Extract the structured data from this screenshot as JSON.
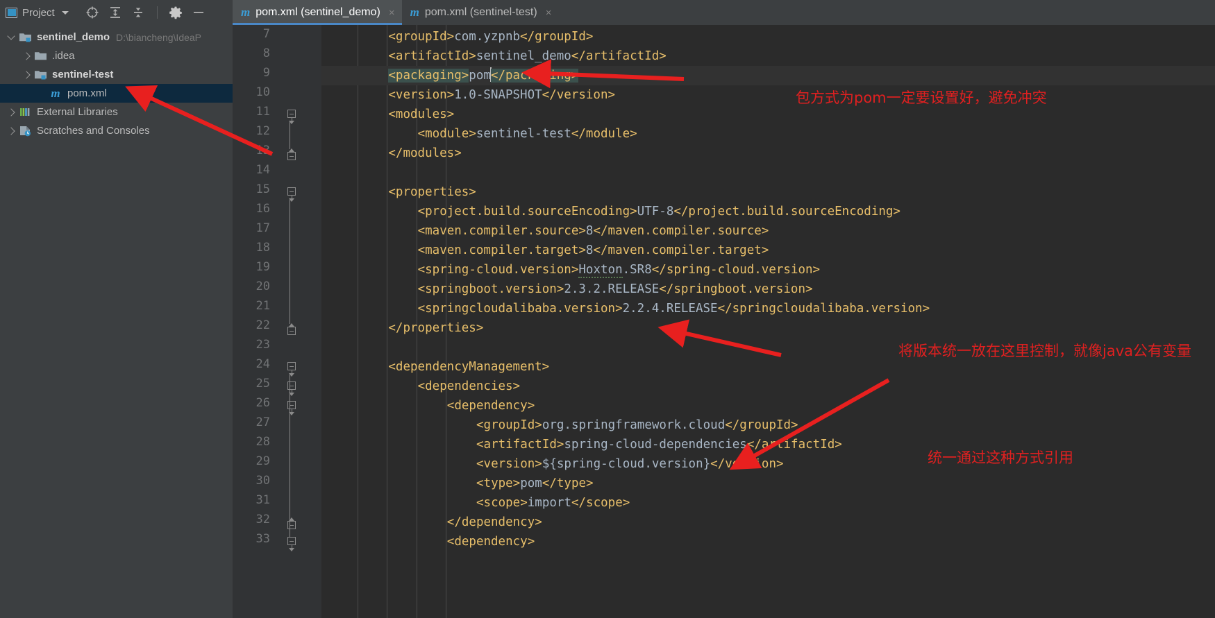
{
  "project_toolbar": {
    "label": "Project",
    "dropdown_caret": "chevron-down-icon",
    "icons": [
      "locate-icon",
      "expand-all-icon",
      "collapse-all-icon",
      "settings-gear-icon",
      "minimize-icon"
    ]
  },
  "tabs": [
    {
      "icon": "m",
      "label": "pom.xml (sentinel_demo)",
      "close": "×",
      "active": true
    },
    {
      "icon": "m",
      "label": "pom.xml (sentinel-test)",
      "close": "×",
      "active": false
    }
  ],
  "tree": [
    {
      "label": "sentinel_demo",
      "path": "D:\\biancheng\\IdeaP",
      "arrow": "open",
      "indent": 1,
      "icon": "module-folder-icon",
      "bold": true,
      "selected": false
    },
    {
      "label": ".idea",
      "path": "",
      "arrow": "closed",
      "indent": 2,
      "icon": "folder-icon",
      "bold": false,
      "selected": false
    },
    {
      "label": "sentinel-test",
      "path": "",
      "arrow": "closed",
      "indent": 2,
      "icon": "module-folder-icon",
      "bold": true,
      "selected": false
    },
    {
      "label": "pom.xml",
      "path": "",
      "arrow": "none",
      "indent": 3,
      "icon": "maven-m-icon",
      "bold": false,
      "selected": true
    },
    {
      "label": "External Libraries",
      "path": "",
      "arrow": "closed",
      "indent": 1,
      "icon": "libraries-icon",
      "bold": false,
      "selected": false
    },
    {
      "label": "Scratches and Consoles",
      "path": "",
      "arrow": "closed",
      "indent": 1,
      "icon": "scratches-icon",
      "bold": false,
      "selected": false
    }
  ],
  "editor": {
    "first_line_number": 7,
    "caret_line": 9,
    "lines": [
      {
        "n": 7,
        "indent": 2,
        "segs": [
          {
            "t": "<groupId>",
            "c": "tg"
          },
          {
            "t": "com.yzpnb",
            "c": "val"
          },
          {
            "t": "</groupId>",
            "c": "tg"
          }
        ]
      },
      {
        "n": 8,
        "indent": 2,
        "segs": [
          {
            "t": "<artifactId>",
            "c": "tg"
          },
          {
            "t": "sentinel_demo",
            "c": "val"
          },
          {
            "t": "</artifactId>",
            "c": "tg"
          }
        ]
      },
      {
        "n": 9,
        "indent": 2,
        "segs": [
          {
            "t": "<packaging>",
            "c": "tg hl"
          },
          {
            "t": "pom",
            "c": "val"
          },
          {
            "t": "CARET",
            "c": "caret"
          },
          {
            "t": "</packaging>",
            "c": "tg hl"
          }
        ]
      },
      {
        "n": 10,
        "indent": 2,
        "segs": [
          {
            "t": "<version>",
            "c": "tg"
          },
          {
            "t": "1.0-SNAPSHOT",
            "c": "val"
          },
          {
            "t": "</version>",
            "c": "tg"
          }
        ]
      },
      {
        "n": 11,
        "indent": 2,
        "segs": [
          {
            "t": "<modules>",
            "c": "tg"
          }
        ]
      },
      {
        "n": 12,
        "indent": 3,
        "segs": [
          {
            "t": "<module>",
            "c": "tg"
          },
          {
            "t": "sentinel-test",
            "c": "val"
          },
          {
            "t": "</module>",
            "c": "tg"
          }
        ]
      },
      {
        "n": 13,
        "indent": 2,
        "segs": [
          {
            "t": "</modules>",
            "c": "tg"
          }
        ]
      },
      {
        "n": 14,
        "indent": 0,
        "segs": []
      },
      {
        "n": 15,
        "indent": 2,
        "segs": [
          {
            "t": "<properties>",
            "c": "tg"
          }
        ]
      },
      {
        "n": 16,
        "indent": 3,
        "segs": [
          {
            "t": "<project.build.sourceEncoding>",
            "c": "tg"
          },
          {
            "t": "UTF-8",
            "c": "val"
          },
          {
            "t": "</project.build.sourceEncoding>",
            "c": "tg"
          }
        ]
      },
      {
        "n": 17,
        "indent": 3,
        "segs": [
          {
            "t": "<maven.compiler.source>",
            "c": "tg"
          },
          {
            "t": "8",
            "c": "val"
          },
          {
            "t": "</maven.compiler.source>",
            "c": "tg"
          }
        ]
      },
      {
        "n": 18,
        "indent": 3,
        "segs": [
          {
            "t": "<maven.compiler.target>",
            "c": "tg"
          },
          {
            "t": "8",
            "c": "val"
          },
          {
            "t": "</maven.compiler.target>",
            "c": "tg"
          }
        ]
      },
      {
        "n": 19,
        "indent": 3,
        "segs": [
          {
            "t": "<spring-cloud.version>",
            "c": "tg"
          },
          {
            "t": "Hoxton",
            "c": "val typo"
          },
          {
            "t": ".SR8",
            "c": "val"
          },
          {
            "t": "</spring-cloud.version>",
            "c": "tg"
          }
        ]
      },
      {
        "n": 20,
        "indent": 3,
        "segs": [
          {
            "t": "<springboot.version>",
            "c": "tg"
          },
          {
            "t": "2.3.2.RELEASE",
            "c": "val"
          },
          {
            "t": "</springboot.version>",
            "c": "tg"
          }
        ]
      },
      {
        "n": 21,
        "indent": 3,
        "segs": [
          {
            "t": "<springcloudalibaba.version>",
            "c": "tg"
          },
          {
            "t": "2.2.4.RELEASE",
            "c": "val"
          },
          {
            "t": "</springcloudalibaba.version>",
            "c": "tg"
          }
        ]
      },
      {
        "n": 22,
        "indent": 2,
        "segs": [
          {
            "t": "</properties>",
            "c": "tg"
          }
        ]
      },
      {
        "n": 23,
        "indent": 0,
        "segs": []
      },
      {
        "n": 24,
        "indent": 2,
        "segs": [
          {
            "t": "<dependencyManagement>",
            "c": "tg"
          }
        ]
      },
      {
        "n": 25,
        "indent": 3,
        "segs": [
          {
            "t": "<dependencies>",
            "c": "tg"
          }
        ]
      },
      {
        "n": 26,
        "indent": 4,
        "segs": [
          {
            "t": "<dependency>",
            "c": "tg"
          }
        ]
      },
      {
        "n": 27,
        "indent": 5,
        "segs": [
          {
            "t": "<groupId>",
            "c": "tg"
          },
          {
            "t": "org.springframework.cloud",
            "c": "val"
          },
          {
            "t": "</groupId>",
            "c": "tg"
          }
        ]
      },
      {
        "n": 28,
        "indent": 5,
        "segs": [
          {
            "t": "<artifactId>",
            "c": "tg"
          },
          {
            "t": "spring-cloud-dependencies",
            "c": "val"
          },
          {
            "t": "</artifactId>",
            "c": "tg"
          }
        ]
      },
      {
        "n": 29,
        "indent": 5,
        "segs": [
          {
            "t": "<version>",
            "c": "tg"
          },
          {
            "t": "${spring-cloud.version}",
            "c": "val"
          },
          {
            "t": "</version>",
            "c": "tg"
          }
        ]
      },
      {
        "n": 30,
        "indent": 5,
        "segs": [
          {
            "t": "<type>",
            "c": "tg"
          },
          {
            "t": "pom",
            "c": "val"
          },
          {
            "t": "</type>",
            "c": "tg"
          }
        ]
      },
      {
        "n": 31,
        "indent": 5,
        "segs": [
          {
            "t": "<scope>",
            "c": "tg"
          },
          {
            "t": "import",
            "c": "val"
          },
          {
            "t": "</scope>",
            "c": "tg"
          }
        ]
      },
      {
        "n": 32,
        "indent": 4,
        "segs": [
          {
            "t": "</dependency>",
            "c": "tg"
          }
        ]
      },
      {
        "n": 33,
        "indent": 4,
        "segs": [
          {
            "t": "<dependency>",
            "c": "tg"
          }
        ]
      }
    ],
    "folds": [
      {
        "line": 11,
        "type": "open"
      },
      {
        "line": 13,
        "type": "close"
      },
      {
        "line": 15,
        "type": "open"
      },
      {
        "line": 22,
        "type": "close"
      },
      {
        "line": 24,
        "type": "open"
      },
      {
        "line": 25,
        "type": "open"
      },
      {
        "line": 26,
        "type": "open"
      },
      {
        "line": 32,
        "type": "close"
      },
      {
        "line": 33,
        "type": "open"
      }
    ]
  },
  "annotations": {
    "color": "#e02020",
    "texts": [
      {
        "id": "anno-packaging",
        "text": "包方式为pom一定要设置好，避免冲突"
      },
      {
        "id": "anno-properties",
        "text": "将版本统一放在这里控制，就像java公有变量"
      },
      {
        "id": "anno-version-ref",
        "text": "统一通过这种方式引用"
      }
    ],
    "arrows": [
      {
        "id": "arrow-to-pomxml"
      },
      {
        "id": "arrow-to-packaging"
      },
      {
        "id": "arrow-to-properties-end"
      },
      {
        "id": "arrow-to-version-ref"
      }
    ]
  }
}
